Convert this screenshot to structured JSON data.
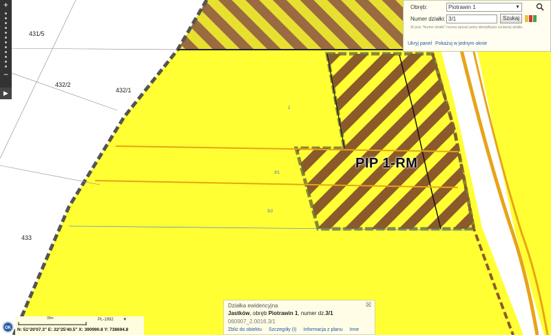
{
  "map": {
    "parcel_labels": [
      "431/5",
      "432/2",
      "432/1",
      "433"
    ],
    "small_labels": [
      "2",
      "3/1",
      "3/2"
    ],
    "zone_label": "PIP 1-RM"
  },
  "toolbar": {
    "zoom_in": "+",
    "zoom_out": "−",
    "play": "▶"
  },
  "search_panel": {
    "precinct_label": "Obręb:",
    "precinct_value": "Piotrawin 1",
    "parcel_label": "Numer działki:",
    "parcel_value": "3/1",
    "search_button": "Szukaj",
    "hint": "W polu \"Numer działki\" można wpisać pełny identyfikator szukanej działki.",
    "hide_panel": "Ukryj panel",
    "show_one_window": "Pokażuj w jednym oknie",
    "swatch_colors": [
      "#e8c24a",
      "#d63a2a",
      "#4aa046"
    ]
  },
  "info_popup": {
    "title": "Działka ewidencyjna",
    "place": "Jastków",
    "mid": ", obręb ",
    "precinct": "Piotrawin 1",
    "tail": ", numer dz.",
    "parcel": "3/1",
    "identifier": "060907_2.0016.3/1",
    "links": [
      "Zbliż do obiektu",
      "Szczegóły (I)",
      "Informacja z planu",
      "Inne"
    ]
  },
  "status": {
    "scale_label": "30m",
    "crs": "PL-1992",
    "coords": "N: 51°20'07.3\"  E: 22°25'40.5\"  X: 390990.8  Y: 738694.8",
    "ok": "OK"
  },
  "colors": {
    "zone_yellow": "#ffff33",
    "hatch_brown": "#8b5a2b",
    "road_orange": "#e8a317",
    "boundary_dark": "#555555"
  }
}
